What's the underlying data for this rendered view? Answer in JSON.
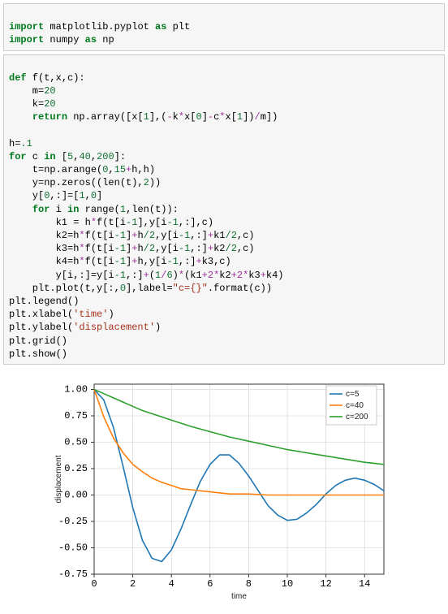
{
  "code1": {
    "l1a": "import",
    "l1b": " matplotlib.pyplot ",
    "l1c": "as",
    "l1d": " plt",
    "l2a": "import",
    "l2b": " numpy ",
    "l2c": "as",
    "l2d": " np"
  },
  "code2": {
    "l1a": "def",
    "l1b": " f(t,x,c):",
    "l2a": "    m=",
    "l2b": "20",
    "l3a": "    k=",
    "l3b": "20",
    "l4a": "    ",
    "l4b": "return",
    "l4c": " np.array([x[",
    "l4d": "1",
    "l4e": "],(",
    "l4f": "-",
    "l4g": "k",
    "l4h": "*",
    "l4i": "x[",
    "l4j": "0",
    "l4k": "]",
    "l4l": "-",
    "l4m": "c",
    "l4n": "*",
    "l4o": "x[",
    "l4p": "1",
    "l4q": "])",
    "l4r": "/",
    "l4s": "m])",
    "l6a": "h=",
    "l6b": ".1",
    "l7a": "for",
    "l7b": " c ",
    "l7c": "in",
    "l7d": " [",
    "l7e": "5",
    "l7f": ",",
    "l7g": "40",
    "l7h": ",",
    "l7i": "200",
    "l7j": "]:",
    "l8a": "    t=np.arange(",
    "l8b": "0",
    "l8c": ",",
    "l8d": "15",
    "l8e": "+",
    "l8f": "h,h)",
    "l9a": "    y=np.zeros((len(t),",
    "l9b": "2",
    "l9c": "))",
    "l10a": "    y[",
    "l10b": "0",
    "l10c": ",:]=[",
    "l10d": "1",
    "l10e": ",",
    "l10f": "0",
    "l10g": "]",
    "l11a": "    ",
    "l11b": "for",
    "l11c": " i ",
    "l11d": "in",
    "l11e": " range(",
    "l11f": "1",
    "l11g": ",len(t)):",
    "l12a": "        k1 = h",
    "l12b": "*",
    "l12c": "f(t[i",
    "l12d": "-1",
    "l12e": "],y[i",
    "l12f": "-1",
    "l12g": ",:],c)",
    "l13a": "        k2=h",
    "l13b": "*",
    "l13c": "f(t[i",
    "l13d": "-1",
    "l13e": "]",
    "l13f": "+",
    "l13g": "h",
    "l13h": "/2",
    "l13i": ",y[i",
    "l13j": "-1",
    "l13k": ",:]",
    "l13l": "+",
    "l13m": "k1",
    "l13n": "/2",
    "l13o": ",c)",
    "l14a": "        k3=h",
    "l14b": "*",
    "l14c": "f(t[i",
    "l14d": "-1",
    "l14e": "]",
    "l14f": "+",
    "l14g": "h",
    "l14h": "/2",
    "l14i": ",y[i",
    "l14j": "-1",
    "l14k": ",:]",
    "l14l": "+",
    "l14m": "k2",
    "l14n": "/2",
    "l14o": ",c)",
    "l15a": "        k4=h",
    "l15b": "*",
    "l15c": "f(t[i",
    "l15d": "-1",
    "l15e": "]",
    "l15f": "+",
    "l15g": "h,y[i",
    "l15h": "-1",
    "l15i": ",:]",
    "l15j": "+",
    "l15k": "k3,c)",
    "l16a": "        y[i,:]=y[i",
    "l16b": "-1",
    "l16c": ",:]",
    "l16d": "+",
    "l16e": "(",
    "l16f": "1",
    "l16g": "/",
    "l16h": "6",
    "l16i": ")",
    "l16j": "*",
    "l16k": "(k1",
    "l16l": "+2*",
    "l16m": "k2",
    "l16n": "+2*",
    "l16o": "k3",
    "l16p": "+",
    "l16q": "k4)",
    "l17a": "    plt.plot(t,y[:,",
    "l17b": "0",
    "l17c": "],label=",
    "l17d": "\"c={}\"",
    "l17e": ".format(c))",
    "l18": "plt.legend()",
    "l19a": "plt.xlabel(",
    "l19b": "'time'",
    "l19c": ")",
    "l20a": "plt.ylabel(",
    "l20b": "'displacement'",
    "l20c": ")",
    "l21": "plt.grid()",
    "l22": "plt.show()"
  },
  "chart_data": {
    "type": "line",
    "title": "",
    "xlabel": "time",
    "ylabel": "displacement",
    "xlim": [
      0,
      15
    ],
    "ylim": [
      -0.75,
      1.05
    ],
    "xticks": [
      0,
      2,
      4,
      6,
      8,
      10,
      12,
      14
    ],
    "yticks": [
      -0.75,
      -0.5,
      -0.25,
      0.0,
      0.25,
      0.5,
      0.75,
      1.0
    ],
    "series": [
      {
        "name": "c=5",
        "color": "#1f77b4",
        "x": [
          0,
          0.5,
          1,
          1.5,
          2,
          2.5,
          3,
          3.5,
          4,
          4.5,
          5,
          5.5,
          6,
          6.5,
          7,
          7.5,
          8,
          8.5,
          9,
          9.5,
          10,
          10.5,
          11,
          11.5,
          12,
          12.5,
          13,
          13.5,
          14,
          14.5,
          15
        ],
        "y": [
          1.0,
          0.9,
          0.64,
          0.27,
          -0.12,
          -0.43,
          -0.6,
          -0.63,
          -0.52,
          -0.32,
          -0.09,
          0.13,
          0.29,
          0.38,
          0.38,
          0.3,
          0.18,
          0.04,
          -0.1,
          -0.19,
          -0.24,
          -0.23,
          -0.17,
          -0.09,
          0.01,
          0.09,
          0.14,
          0.16,
          0.14,
          0.1,
          0.04
        ]
      },
      {
        "name": "c=40",
        "color": "#ff7f0e",
        "x": [
          0,
          0.5,
          1,
          1.5,
          2,
          2.5,
          3,
          3.5,
          4,
          4.5,
          5,
          6,
          7,
          8,
          9,
          10,
          11,
          12,
          13,
          14,
          15
        ],
        "y": [
          1.0,
          0.74,
          0.54,
          0.4,
          0.29,
          0.22,
          0.16,
          0.12,
          0.09,
          0.06,
          0.05,
          0.03,
          0.01,
          0.01,
          0.0,
          0.0,
          0.0,
          0.0,
          0.0,
          0.0,
          0.0
        ]
      },
      {
        "name": "c=200",
        "color": "#2ca02c",
        "x": [
          0,
          0.5,
          1,
          1.5,
          2,
          2.5,
          3,
          4,
          5,
          6,
          7,
          8,
          9,
          10,
          11,
          12,
          13,
          14,
          15
        ],
        "y": [
          1.0,
          0.96,
          0.92,
          0.88,
          0.84,
          0.8,
          0.77,
          0.71,
          0.65,
          0.6,
          0.55,
          0.51,
          0.47,
          0.43,
          0.4,
          0.37,
          0.34,
          0.31,
          0.29
        ]
      }
    ],
    "legend_pos": "upper right"
  }
}
